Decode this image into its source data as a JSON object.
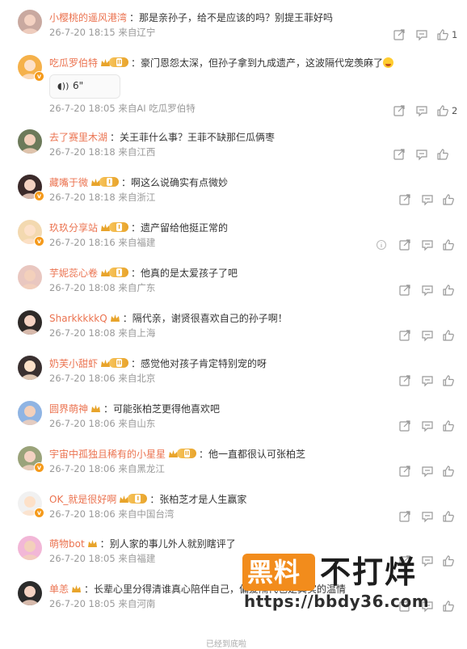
{
  "colors": {
    "username": "#eb7350",
    "meta": "#999999",
    "text": "#333333",
    "badge": "#f59a1b"
  },
  "comments": [
    {
      "username": "小樱桃的遥风港湾",
      "badge": "",
      "text": "那是亲孙子，给不是应该的吗？别提王菲好吗",
      "meta": "26-7-20 18:15 来自辽宁",
      "likes": "1",
      "avatar_color": "#c9a9a0"
    },
    {
      "username": "吃瓜罗伯特",
      "badge": "II",
      "text": "豪门恩怨太深，但孙子拿到九成遗产，这波隔代宠羡麻了",
      "voice": "6\"",
      "meta": "26-7-20 18:05 来自AI 吃瓜罗伯特",
      "likes": "2",
      "avatar_color": "#f5b14a"
    },
    {
      "username": "去了赛里木湖",
      "badge": "",
      "text": "关王菲什么事？王菲不缺那仨瓜俩枣",
      "meta": "26-7-20 18:18 来自江西",
      "likes": "",
      "avatar_color": "#6c7a5a"
    },
    {
      "username": "藏嘴于微",
      "badge": "I",
      "text": "啊这么说确实有点微妙",
      "meta": "26-7-20 18:18 来自浙江",
      "likes": "",
      "avatar_color": "#3b2a2a"
    },
    {
      "username": "玖玖分享站",
      "badge": "I",
      "text": "遗产留给他挺正常的",
      "meta": "26-7-20 18:16 来自福建",
      "likes": "",
      "avatar_color": "#f3d9b0"
    },
    {
      "username": "芋妮蕊心卷",
      "badge": "I",
      "text": "他真的是太爱孩子了吧",
      "meta": "26-7-20 18:08 来自广东",
      "likes": "",
      "avatar_color": "#e9c7c0"
    },
    {
      "username": "SharkkkkkQ",
      "badge": "",
      "text": "隔代亲，谢贤很喜欢自己的孙子啊！",
      "meta": "26-7-20 18:08 来自上海",
      "likes": "",
      "avatar_color": "#2e2a28"
    },
    {
      "username": "奶芙小甜虾",
      "badge": "II",
      "text": "感觉他对孩子肯定特别宠的呀",
      "meta": "26-7-20 18:06 来自北京",
      "likes": "",
      "avatar_color": "#3a3030"
    },
    {
      "username": "圆界萌神",
      "badge": "",
      "text": "可能张柏芝更得他喜欢吧",
      "meta": "26-7-20 18:06 来自山东",
      "likes": "",
      "avatar_color": "#8fb4e3"
    },
    {
      "username": "宇宙中孤独且稀有的小星星",
      "badge": "II",
      "text": "他一直都很认可张柏芝",
      "meta": "26-7-20 18:06 来自黑龙江",
      "likes": "",
      "avatar_color": "#9aa37a"
    },
    {
      "username": "OK_就是很好啊",
      "badge": "I",
      "text": "张柏芝才是人生赢家",
      "meta": "26-7-20 18:06 来自中国台湾",
      "likes": "",
      "avatar_color": "#f1f1f1"
    },
    {
      "username": "萌物bot",
      "badge": "",
      "text": "别人家的事儿外人就别瞎评了",
      "meta": "26-7-20 18:05 来自福建",
      "likes": "",
      "avatar_color": "#f2b7d7"
    },
    {
      "username": "单恙",
      "badge": "",
      "text": "长辈心里分得清谁真心陪伴自己，偏爱隔代也是真实的温情",
      "meta": "26-7-20 18:05 来自河南",
      "likes": "",
      "avatar_color": "#2b2b2b"
    }
  ],
  "watermark": {
    "logo": "黑料",
    "title": "不打烊",
    "url": "https://bbdy36.com"
  },
  "footer": {
    "text": "已经到底啦"
  }
}
